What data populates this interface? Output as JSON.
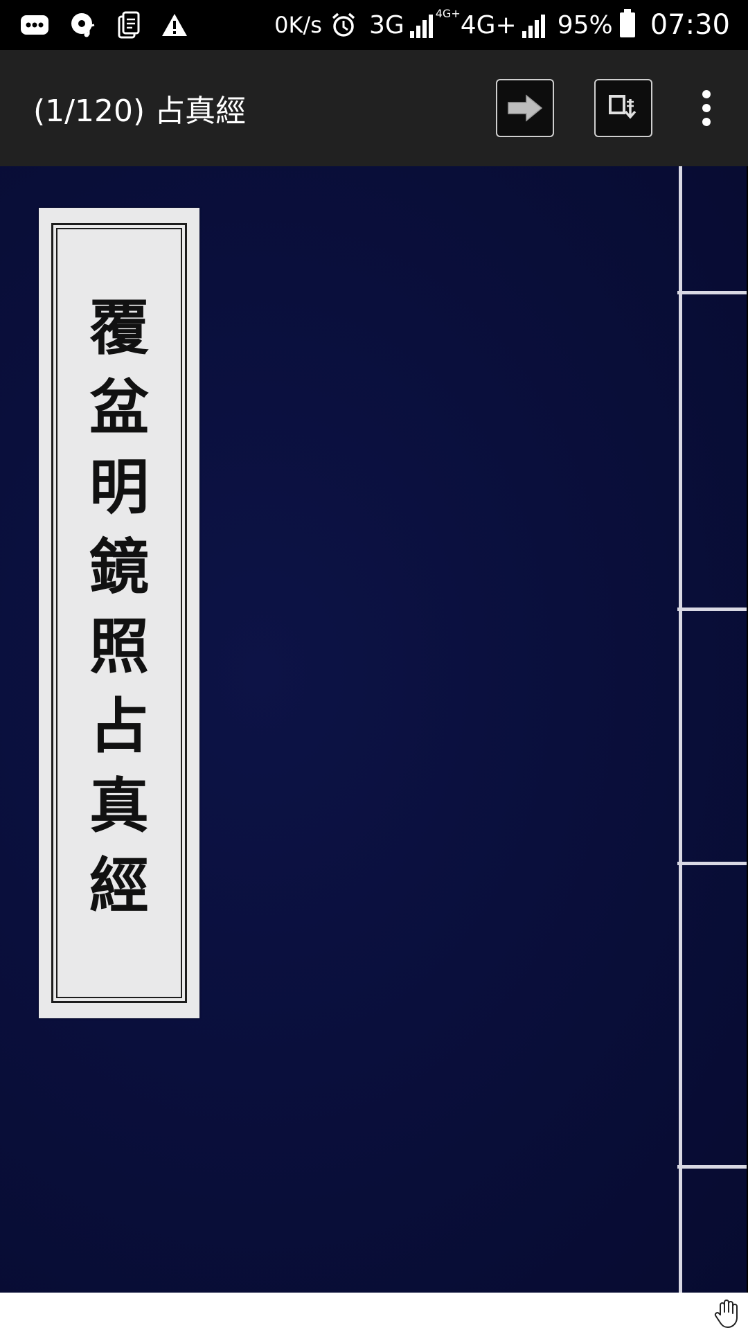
{
  "status_bar": {
    "network_speed": "0K/s",
    "network_1": "3G",
    "network_2": "4G+",
    "network_2_superscript": "4G+",
    "battery": "95%",
    "time": "07:30",
    "icons": [
      "more-notifications-icon",
      "music-disc-icon",
      "document-icon",
      "warning-icon",
      "alarm-clock-icon",
      "signal-icon",
      "signal-icon",
      "battery-icon"
    ]
  },
  "app_bar": {
    "title": "(1/120) 占真經",
    "actions": [
      "next-page-icon",
      "download-page-icon",
      "overflow-menu-icon"
    ]
  },
  "cover": {
    "title_chars": [
      "覆",
      "盆",
      "明",
      "鏡",
      "照",
      "占",
      "真",
      "經"
    ],
    "background_color": "#0a0f3c",
    "label_color": "#e9e9ea"
  },
  "footer": {
    "icon": "hand-cursor-icon"
  }
}
